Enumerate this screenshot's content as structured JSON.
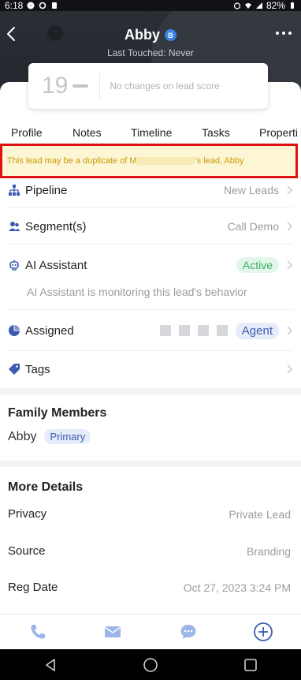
{
  "status_bar": {
    "time": "6:18",
    "battery": "82%"
  },
  "header": {
    "name": "Abby",
    "badge": "B",
    "last_touched": "Last Touched: Never"
  },
  "score": {
    "value": "19",
    "text": "No changes on lead score"
  },
  "tabs": [
    "Profile",
    "Notes",
    "Timeline",
    "Tasks",
    "Properti"
  ],
  "duplicate_banner": {
    "prefix": "This lead may be a duplicate of M",
    "suffix": "'s lead, Abby"
  },
  "rows": {
    "pipeline": {
      "label": "Pipeline",
      "value": "New Leads"
    },
    "segments": {
      "label": "Segment(s)",
      "value": "Call Demo"
    },
    "ai": {
      "label": "AI Assistant",
      "status": "Active",
      "sub": "AI Assistant is monitoring this lead's behavior"
    },
    "assigned": {
      "label": "Assigned",
      "role": "Agent"
    },
    "tags": {
      "label": "Tags"
    }
  },
  "family": {
    "title": "Family Members",
    "name": "Abby",
    "tag": "Primary"
  },
  "more_details": {
    "title": "More Details",
    "items": [
      {
        "label": "Privacy",
        "value": "Private Lead"
      },
      {
        "label": "Source",
        "value": "Branding"
      },
      {
        "label": "Reg Date",
        "value": "Oct 27, 2023 3:24 PM"
      }
    ]
  },
  "colors": {
    "accent": "#3d5bb0",
    "active_green": "#3cab66",
    "banner_text": "#c79a00",
    "banner_border": "#e01010"
  }
}
